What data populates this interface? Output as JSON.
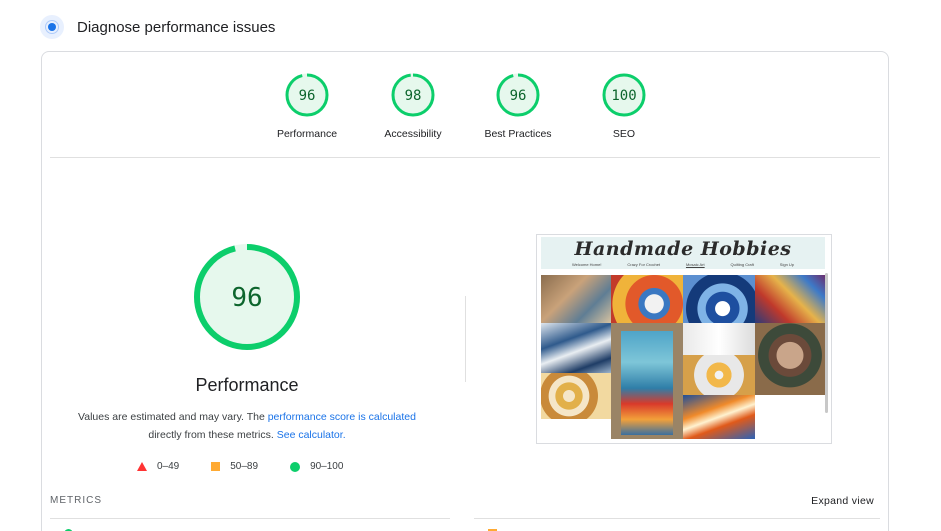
{
  "header": {
    "title": "Diagnose performance issues",
    "icon": "diagnose-icon"
  },
  "gauges": [
    {
      "score": "96",
      "label": "Performance",
      "value": 0.96
    },
    {
      "score": "98",
      "label": "Accessibility",
      "value": 0.98
    },
    {
      "score": "96",
      "label": "Best Practices",
      "value": 0.96
    },
    {
      "score": "100",
      "label": "SEO",
      "value": 1.0
    }
  ],
  "performance": {
    "score": "96",
    "value": 0.96,
    "title": "Performance",
    "desc_start": "Values are estimated and may vary. The ",
    "desc_link1": "performance score is calculated",
    "desc_mid": " directly from these metrics. ",
    "desc_link2": "See calculator.",
    "desc_end": ""
  },
  "legend": [
    {
      "range": "0–49",
      "shape": "triangle",
      "color": "#ff3333"
    },
    {
      "range": "50–89",
      "shape": "square",
      "color": "#ffaa33"
    },
    {
      "range": "90–100",
      "shape": "circle",
      "color": "#0cce6b"
    }
  ],
  "screenshot": {
    "site_title": "Handmade Hobbies",
    "nav": [
      "Welcome Home!",
      "Crazy For Crochet",
      "Mosaic Art",
      "Quilting Craft",
      "Sign Up"
    ]
  },
  "metrics": {
    "label": "METRICS",
    "expand_label": "Expand view"
  },
  "colors": {
    "pass": "#0cce6b",
    "pass_text": "#0d652d",
    "average": "#ffaa33",
    "fail": "#ff3333",
    "link": "#1a73e8"
  }
}
